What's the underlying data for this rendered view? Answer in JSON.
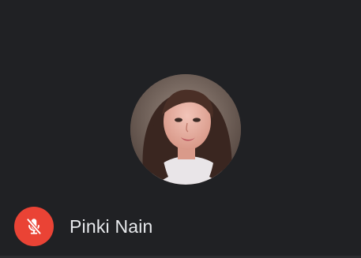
{
  "participant": {
    "name": "Pinki Nain",
    "muted": true
  },
  "icons": {
    "mute": "mic-off-icon",
    "avatar": "participant-avatar"
  },
  "colors": {
    "tile_background": "#202124",
    "mute_badge": "#ea4335",
    "name_text": "#e8eaed"
  }
}
